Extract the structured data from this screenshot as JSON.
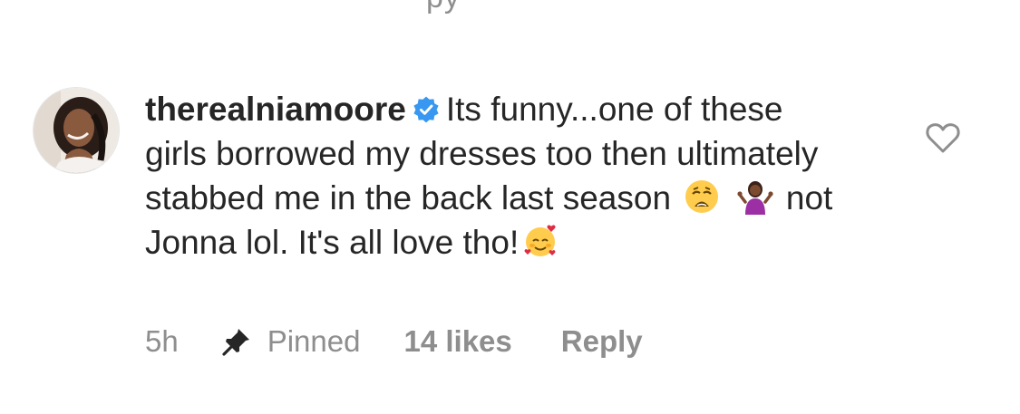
{
  "top_cut_text": "py",
  "comment": {
    "username": "therealniamoore",
    "text_intro": "Its funny...one of these girls borrowed my dresses too then ultimately stabbed me in the back last season",
    "text_middle": "not Jonna lol. It's all love tho!",
    "time": "5h",
    "pinned_label": "Pinned",
    "likes_label": "14 likes",
    "reply_label": "Reply"
  },
  "icons": {
    "verified": "verified-badge-icon",
    "weary": "weary-face-emoji",
    "shrug": "woman-shrugging-emoji",
    "hearts": "smiling-face-with-hearts-emoji",
    "like": "heart-outline-icon",
    "pin": "pin-icon"
  },
  "colors": {
    "text": "#262626",
    "secondary": "#8e8e8e",
    "verified": "#3897f0"
  }
}
